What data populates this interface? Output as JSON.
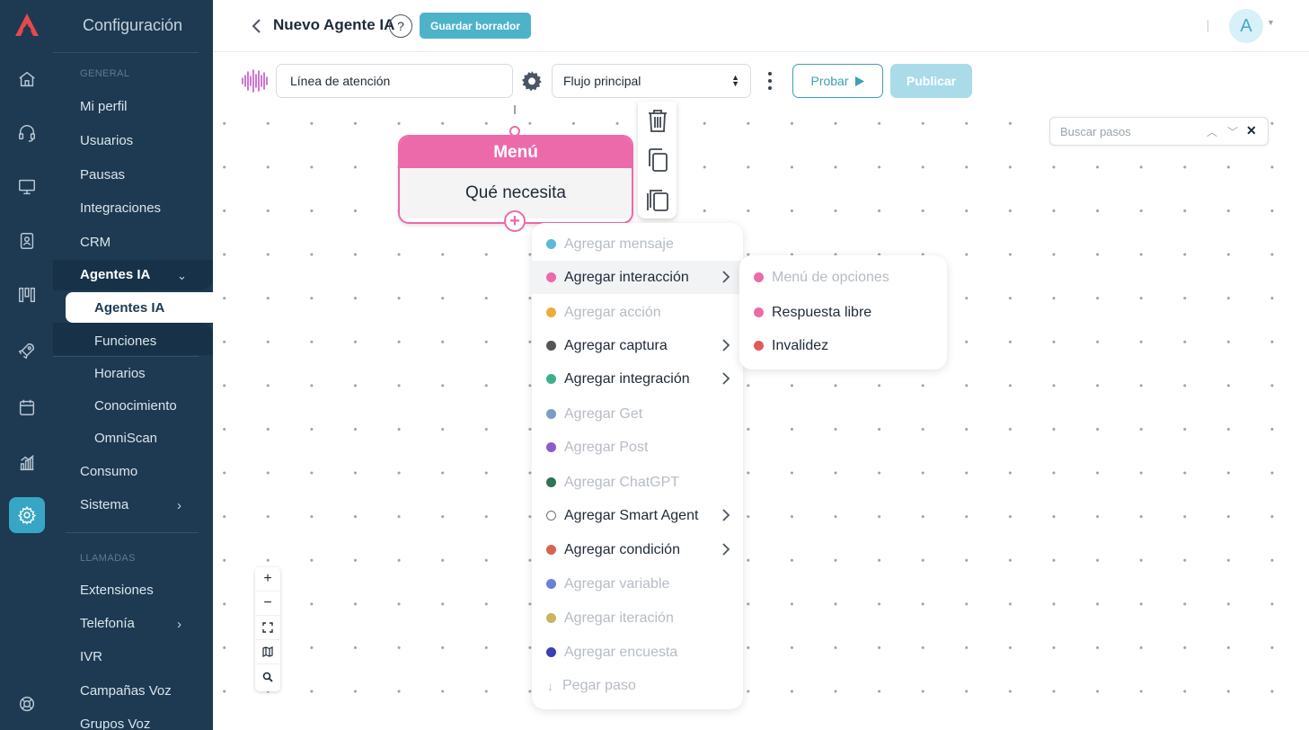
{
  "sidebar": {
    "title": "Configuración",
    "section_general": "GENERAL",
    "items": {
      "mi_perfil": "Mi perfil",
      "usuarios": "Usuarios",
      "pausas": "Pausas",
      "integraciones": "Integraciones",
      "crm": "CRM",
      "agentes_group": "Agentes IA",
      "agentes_ia": "Agentes IA",
      "funciones": "Funciones",
      "horarios": "Horarios",
      "conocimiento": "Conocimiento",
      "omniscan": "OmniScan",
      "consumo": "Consumo",
      "sistema": "Sistema"
    },
    "section_llamadas": "LLAMADAS",
    "llamadas_items": {
      "extensiones": "Extensiones",
      "telefonia": "Telefonía",
      "ivr": "IVR",
      "campanas": "Campañas Voz",
      "grupos": "Grupos Voz"
    }
  },
  "header": {
    "title": "Nuevo Agente IA",
    "help": "?",
    "draft_button": "Guardar borrador",
    "avatar": "A"
  },
  "toolbar": {
    "line_value": "Línea de atención",
    "flow_value": "Flujo principal",
    "test_button": "Probar",
    "publish_button": "Publicar"
  },
  "search": {
    "placeholder": "Buscar pasos"
  },
  "node": {
    "title": "Menú",
    "body": "Qué necesita",
    "add": "+"
  },
  "add_menu": [
    {
      "label": "Agregar mensaje",
      "color": "#5bbad5",
      "enabled": false,
      "submenu": false
    },
    {
      "label": "Agregar interacción",
      "color": "#ec6aa9",
      "enabled": true,
      "submenu": true
    },
    {
      "label": "Agregar acción",
      "color": "#f0a93b",
      "enabled": false,
      "submenu": false
    },
    {
      "label": "Agregar captura",
      "color": "#555555",
      "enabled": true,
      "submenu": true
    },
    {
      "label": "Agregar integración",
      "color": "#3fae8a",
      "enabled": true,
      "submenu": true
    },
    {
      "label": "Agregar Get",
      "color": "#7a9cc6",
      "enabled": false,
      "submenu": false
    },
    {
      "label": "Agregar Post",
      "color": "#8b5cc9",
      "enabled": false,
      "submenu": false
    },
    {
      "label": "Agregar ChatGPT",
      "color": "#2f7256",
      "enabled": false,
      "submenu": false
    },
    {
      "label": "Agregar Smart Agent",
      "color": "#ffffff",
      "enabled": true,
      "submenu": true
    },
    {
      "label": "Agregar condición",
      "color": "#d9634d",
      "enabled": true,
      "submenu": true
    },
    {
      "label": "Agregar variable",
      "color": "#6a7fd9",
      "enabled": false,
      "submenu": false
    },
    {
      "label": "Agregar iteración",
      "color": "#c9b462",
      "enabled": false,
      "submenu": false
    },
    {
      "label": "Agregar encuesta",
      "color": "#3b3fb0",
      "enabled": false,
      "submenu": false
    }
  ],
  "paste_step": "Pegar paso",
  "interaction_submenu": [
    {
      "label": "Menú de opciones",
      "color": "#ec6aa9",
      "enabled": false
    },
    {
      "label": "Respuesta libre",
      "color": "#ec6aa9",
      "enabled": true
    },
    {
      "label": "Invalidez",
      "color": "#e25a5a",
      "enabled": true
    }
  ],
  "zoom_controls": [
    "+",
    "−"
  ]
}
